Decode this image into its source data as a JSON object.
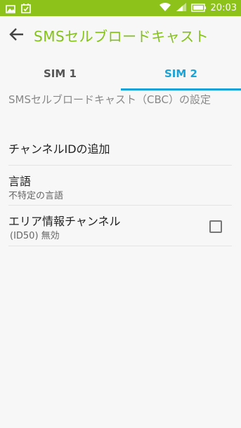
{
  "status_bar": {
    "time": "20:03",
    "icons": [
      "image-icon",
      "calendar-check-icon",
      "wifi-icon",
      "signal-icon",
      "battery-icon"
    ]
  },
  "app_bar": {
    "title": "SMSセルブロードキャスト",
    "back_icon": "arrow-left-icon"
  },
  "tabs": {
    "items": [
      {
        "label": "SIM 1",
        "selected": false
      },
      {
        "label": "SIM 2",
        "selected": true
      }
    ],
    "accent_color": "#1aa3d6"
  },
  "settings": {
    "section_header": "SMSセルブロードキャスト（CBC）の設定",
    "items": [
      {
        "primary": "チャンネルIDの追加"
      },
      {
        "primary": "言語",
        "secondary": "不特定の言語"
      },
      {
        "primary": "エリア情報チャンネル",
        "secondary": "(ID50) 無効",
        "checked": false
      }
    ]
  },
  "colors": {
    "status_bar": "#8cc21a",
    "title": "#83c11a"
  }
}
